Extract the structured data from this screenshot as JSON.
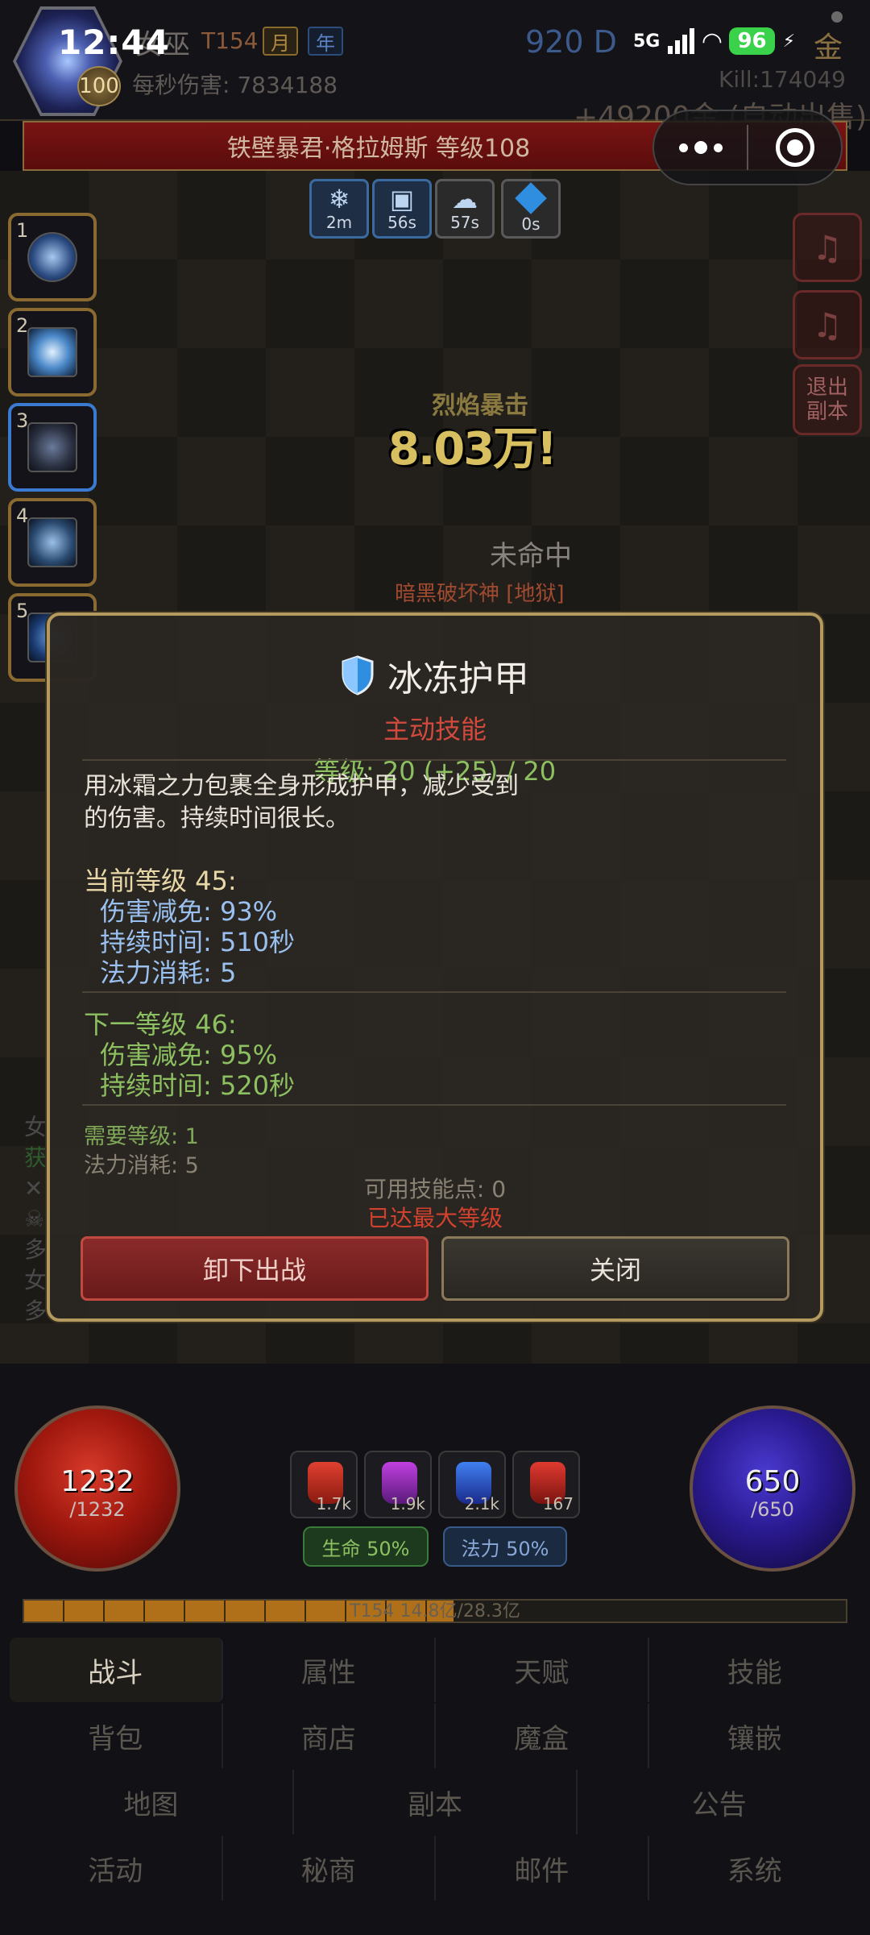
{
  "header": {
    "clock": "12:44",
    "level": "100",
    "char_name": "女巫",
    "tier": "T154",
    "tag_month": "月",
    "tag_year": "年",
    "dps_text": "每秒伤害: 7834188",
    "currency": "920 D",
    "network": "5G",
    "battery": "96",
    "gold_char": "金",
    "kill": "Kill:174049",
    "auto_sell": "+49200金 (自动出售)"
  },
  "boss": {
    "name": "铁壁暴君·格拉姆斯 等级108"
  },
  "buffs": [
    {
      "icon": "❄",
      "time": "2m"
    },
    {
      "icon": "▣",
      "time": "56s"
    },
    {
      "icon": "☁",
      "time": "57s"
    },
    {
      "icon": "",
      "time": "0s"
    }
  ],
  "skill_slots": [
    "1",
    "2",
    "3",
    "4",
    "5"
  ],
  "side_buttons": {
    "exit": "退出副本",
    "mute": "♫"
  },
  "battle": {
    "float_small": "烈焰暴击",
    "float_big": "8.03万!",
    "miss": "未命中",
    "boss_title": "暗黑破坏神 [地狱]"
  },
  "log": [
    "女",
    "获",
    "✕",
    "☠",
    "多",
    "女",
    "多"
  ],
  "modal": {
    "title": "冰冻护甲",
    "type": "主动技能",
    "level": "等级: 20 (+25) / 20",
    "description": "用冰霜之力包裹全身形成护甲，减少受到的伤害。持续时间很长。",
    "current": {
      "title": "当前等级 45:",
      "stats": [
        "伤害减免: 93%",
        "持续时间: 510秒",
        "法力消耗: 5"
      ]
    },
    "next": {
      "title": "下一等级 46:",
      "stats": [
        "伤害减免: 95%",
        "持续时间: 520秒"
      ]
    },
    "req_level": "需要等级: 1",
    "req_mana": "法力消耗: 5",
    "points": "可用技能点: 0",
    "maxed": "已达最大等级",
    "btn_unequip": "卸下出战",
    "btn_close": "关闭"
  },
  "hud": {
    "hp_cur": "1232",
    "hp_max": "/1232",
    "mp_cur": "650",
    "mp_max": "/650",
    "potions": [
      "1.7k",
      "1.9k",
      "2.1k",
      "167"
    ],
    "pill_hp": "生命 50%",
    "pill_mp": "法力 50%",
    "exp_text": "T154 14.8亿/28.3亿",
    "exp_fraction": 0.523
  },
  "nav": {
    "row1": [
      "战斗",
      "属性",
      "天赋",
      "技能"
    ],
    "row2": [
      "背包",
      "商店",
      "魔盒",
      "镶嵌"
    ],
    "row3": [
      "地图",
      "副本",
      "公告"
    ],
    "row4": [
      "活动",
      "秘商",
      "邮件",
      "系统"
    ]
  },
  "colors": {
    "accent_gold": "#b49a5e",
    "danger": "#d24a3e",
    "level_green": "#8cc060",
    "stat_blue": "#9ac0f0"
  }
}
